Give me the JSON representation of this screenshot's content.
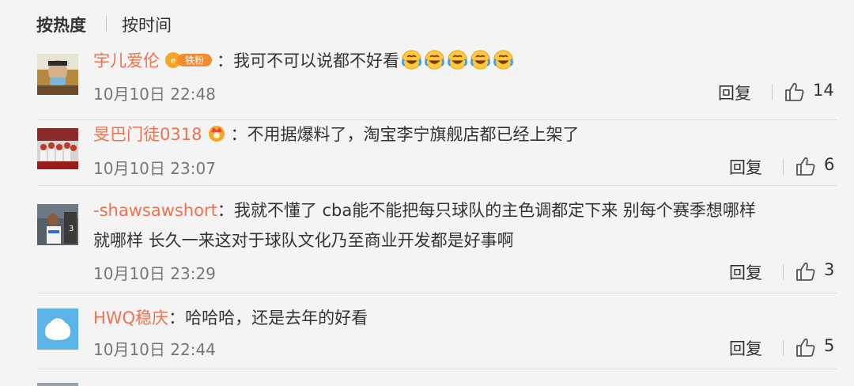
{
  "sort": {
    "active": "按热度",
    "other": "按时间"
  },
  "comments": [
    {
      "user": "宇儿爱伦",
      "badge": "铁粉",
      "text": "：我可不可以说都不好看",
      "time": "10月10日 22:48",
      "reply": "回复",
      "likes": "14"
    },
    {
      "user": "旻巴门徒0318",
      "text": "：不用据爆料了，淘宝李宁旗舰店都已经上架了",
      "time": "10月10日 23:07",
      "reply": "回复",
      "likes": "6"
    },
    {
      "user": "-shawsawshort",
      "text": "：我就不懂了 cba能不能把每只球队的主色调都定下来 别每个赛季想哪样",
      "text2": "就哪样 长久一来这对于球队文化乃至商业开发都是好事啊",
      "time": "10月10日 23:29",
      "reply": "回复",
      "likes": "3"
    },
    {
      "user": "HWQ稳庆",
      "text": "：哈哈哈，还是去年的好看",
      "time": "10月10日 22:44",
      "reply": "回复",
      "likes": "5"
    }
  ],
  "icons": [
    "thumbs-up-icon",
    "laugh-cry-emoji",
    "crown-icon"
  ],
  "colors": {
    "username": "#eb7350",
    "background": "#f4f4f4",
    "text": "#333333",
    "time": "#777777"
  }
}
